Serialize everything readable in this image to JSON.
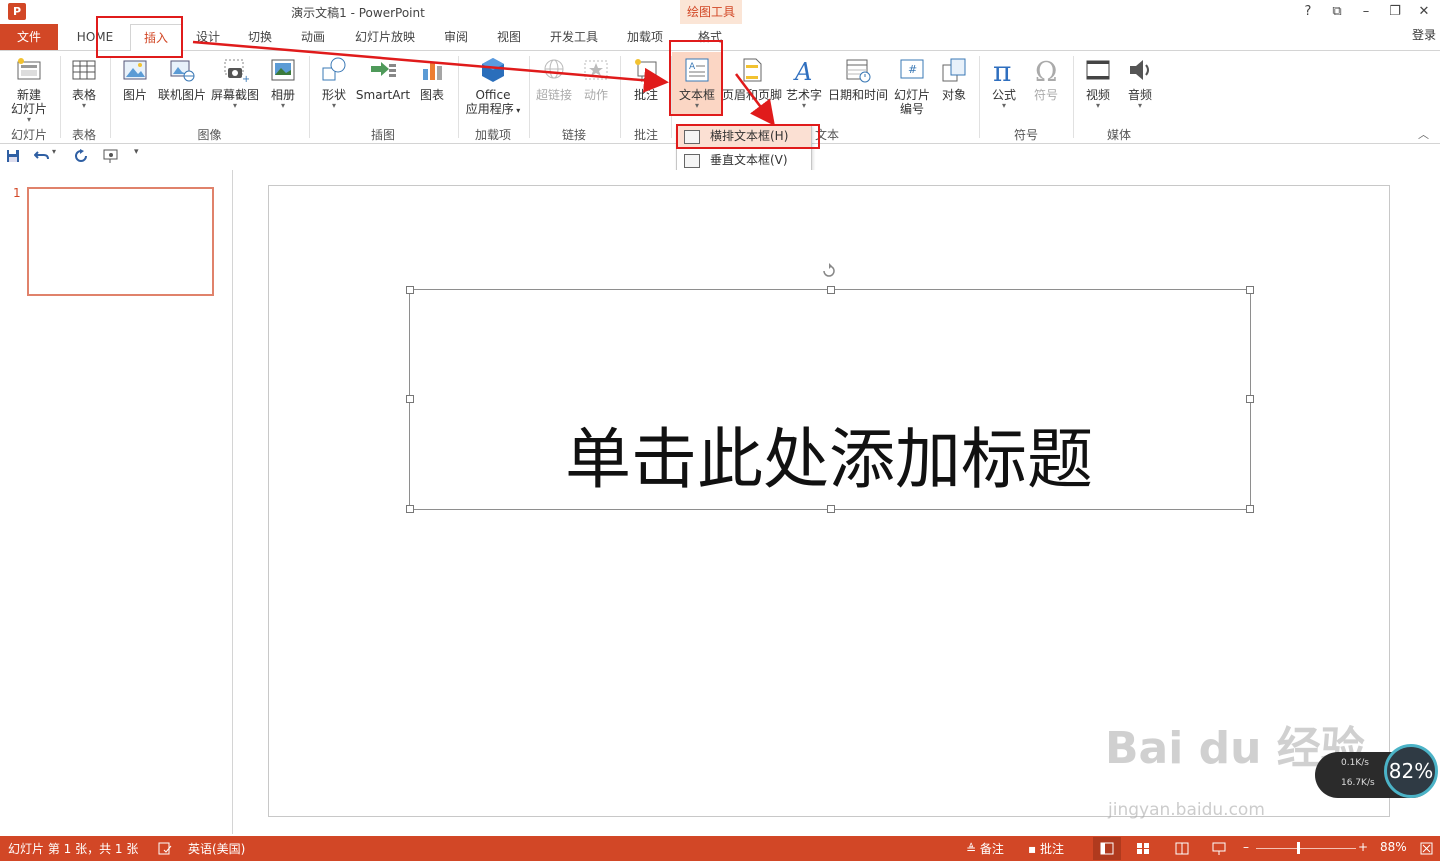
{
  "window": {
    "title": "演示文稿1 - PowerPoint",
    "app_icon": "P",
    "contextual_tab_header": "绘图工具",
    "controls": [
      "?",
      "⧉",
      "–",
      "❐",
      "✕"
    ],
    "login": "登录"
  },
  "tabs": [
    {
      "label": "文件"
    },
    {
      "label": "HOME"
    },
    {
      "label": "插入"
    },
    {
      "label": "设计"
    },
    {
      "label": "切换"
    },
    {
      "label": "动画"
    },
    {
      "label": "幻灯片放映"
    },
    {
      "label": "审阅"
    },
    {
      "label": "视图"
    },
    {
      "label": "开发工具"
    },
    {
      "label": "加载项"
    },
    {
      "label": "格式"
    }
  ],
  "ribbon": {
    "buttons": {
      "new_slide": "新建\n幻灯片",
      "table": "表格",
      "pictures": "图片",
      "online_pictures": "联机图片",
      "screenshot": "屏幕截图",
      "album": "相册",
      "shapes": "形状",
      "smartart": "SmartArt",
      "chart": "图表",
      "office_apps_1": "Office",
      "office_apps_2": "应用程序",
      "hyperlink": "超链接",
      "action": "动作",
      "comment": "批注",
      "textbox": "文本框",
      "header_footer": "页眉和页脚",
      "wordart": "艺术字",
      "datetime": "日期和时间",
      "slide_number_1": "幻灯片",
      "slide_number_2": "编号",
      "object": "对象",
      "equation": "公式",
      "symbol": "符号",
      "video": "视频",
      "audio": "音频"
    },
    "groups": {
      "slides": "幻灯片",
      "tables": "表格",
      "images": "图像",
      "illustrations": "插图",
      "addins": "加载项",
      "links": "链接",
      "comments": "批注",
      "text": "文本",
      "symbols": "符号",
      "media": "媒体"
    }
  },
  "dropdown": {
    "items": [
      {
        "label": "横排文本框(H)"
      },
      {
        "label": "垂直文本框(V)"
      }
    ]
  },
  "thumbnail": {
    "number": "1"
  },
  "slide": {
    "title_placeholder": "单击此处添加标题"
  },
  "status": {
    "slide_info": "幻灯片 第 1 张，共 1 张",
    "language": "英语(美国)",
    "notes": "备注",
    "comments": "批注",
    "zoom": "88%"
  },
  "watermark": {
    "brand": "Bai du 经验",
    "url": "jingyan.baidu.com"
  },
  "speed_widget": {
    "up": "0.1K/s",
    "down": "16.7K/s",
    "percent": "82%"
  },
  "colors": {
    "accent": "#d24726",
    "annotation_red": "#e01b1b"
  }
}
